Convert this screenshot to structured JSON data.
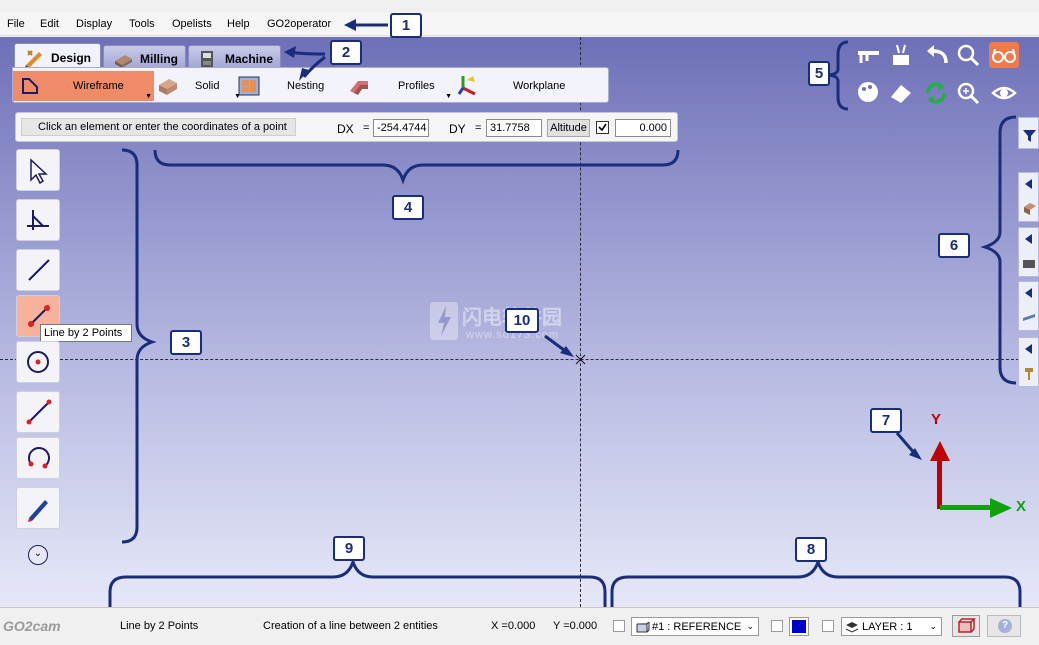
{
  "menu": [
    "File",
    "Edit",
    "Display",
    "Tools",
    "Opelists",
    "Help",
    "GO2operator"
  ],
  "tabs": {
    "design": "Design",
    "milling": "Milling",
    "machine": "Machine"
  },
  "ribbon": {
    "wireframe": "Wireframe",
    "solid": "Solid",
    "nesting": "Nesting",
    "profiles": "Profiles",
    "workplane": "Workplane"
  },
  "coords": {
    "prompt": "Click an element or enter the coordinates of a point",
    "dx_label": "DX",
    "eq": "=",
    "dx_value": "-254.4744",
    "dy_label": "DY",
    "dy_value": "31.7758",
    "altitude_label": "Altitude",
    "altitude_value": "0.000"
  },
  "tooltip": "Line by 2 Points",
  "axes": {
    "y": "Y",
    "x": "X"
  },
  "watermark": {
    "line1": "闪电软件园",
    "line2": "www.sd173.com"
  },
  "callouts": [
    "1",
    "2",
    "3",
    "4",
    "5",
    "6",
    "7",
    "8",
    "9",
    "10"
  ],
  "status": {
    "logo": "GO2cam",
    "command": "Line by 2 Points",
    "description": "Creation of a line between 2 entities",
    "x": "X =0.000",
    "y": "Y =0.000",
    "reference": "#1 : REFERENCE",
    "layer": "LAYER :  1"
  },
  "colors": {
    "accent": "#ef8b66",
    "callout": "#1a2d7a",
    "y_axis": "#c00000",
    "x_axis": "#10a010",
    "color_swatch": "#0000cc"
  }
}
